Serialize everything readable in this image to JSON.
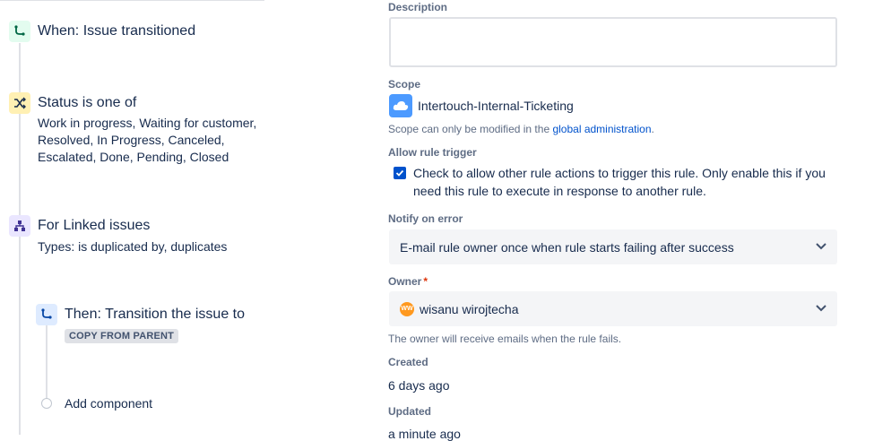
{
  "rule": {
    "trigger": {
      "title": "When: Issue transitioned"
    },
    "condition": {
      "title": "Status is one of",
      "detail": "Work in progress, Waiting for customer, Resolved, In Progress, Canceled, Escalated, Done, Pending, Closed"
    },
    "branch": {
      "title": "For Linked issues",
      "detail": "Types: is duplicated by, duplicates"
    },
    "action": {
      "title": "Then: Transition the issue to",
      "lozenge": "COPY FROM PARENT"
    },
    "add_component": "Add component"
  },
  "details": {
    "description_label": "Description",
    "scope_label": "Scope",
    "scope_value": "Intertouch-Internal-Ticketing",
    "scope_help_prefix": "Scope can only be modified in the",
    "scope_help_link": "global administration",
    "scope_help_suffix": ".",
    "allow_trigger_label": "Allow rule trigger",
    "allow_trigger_text": "Check to allow other rule actions to trigger this rule. Only enable this if you need this rule to execute in response to another rule.",
    "allow_trigger_checked": true,
    "notify_label": "Notify on error",
    "notify_value": "E-mail rule owner once when rule starts failing after success",
    "owner_label": "Owner",
    "owner_required": "*",
    "owner_initials": "WW",
    "owner_value": "wisanu wirojtecha",
    "owner_help": "The owner will receive emails when the rule fails.",
    "created_label": "Created",
    "created_value": "6 days ago",
    "updated_label": "Updated",
    "updated_value": "a minute ago"
  },
  "icons": {
    "trigger": "trigger-icon",
    "condition": "shuffle-icon",
    "branch": "branch-icon",
    "action": "action-icon",
    "scope": "cloud-icon",
    "dropdown": "chevron-down-icon"
  }
}
